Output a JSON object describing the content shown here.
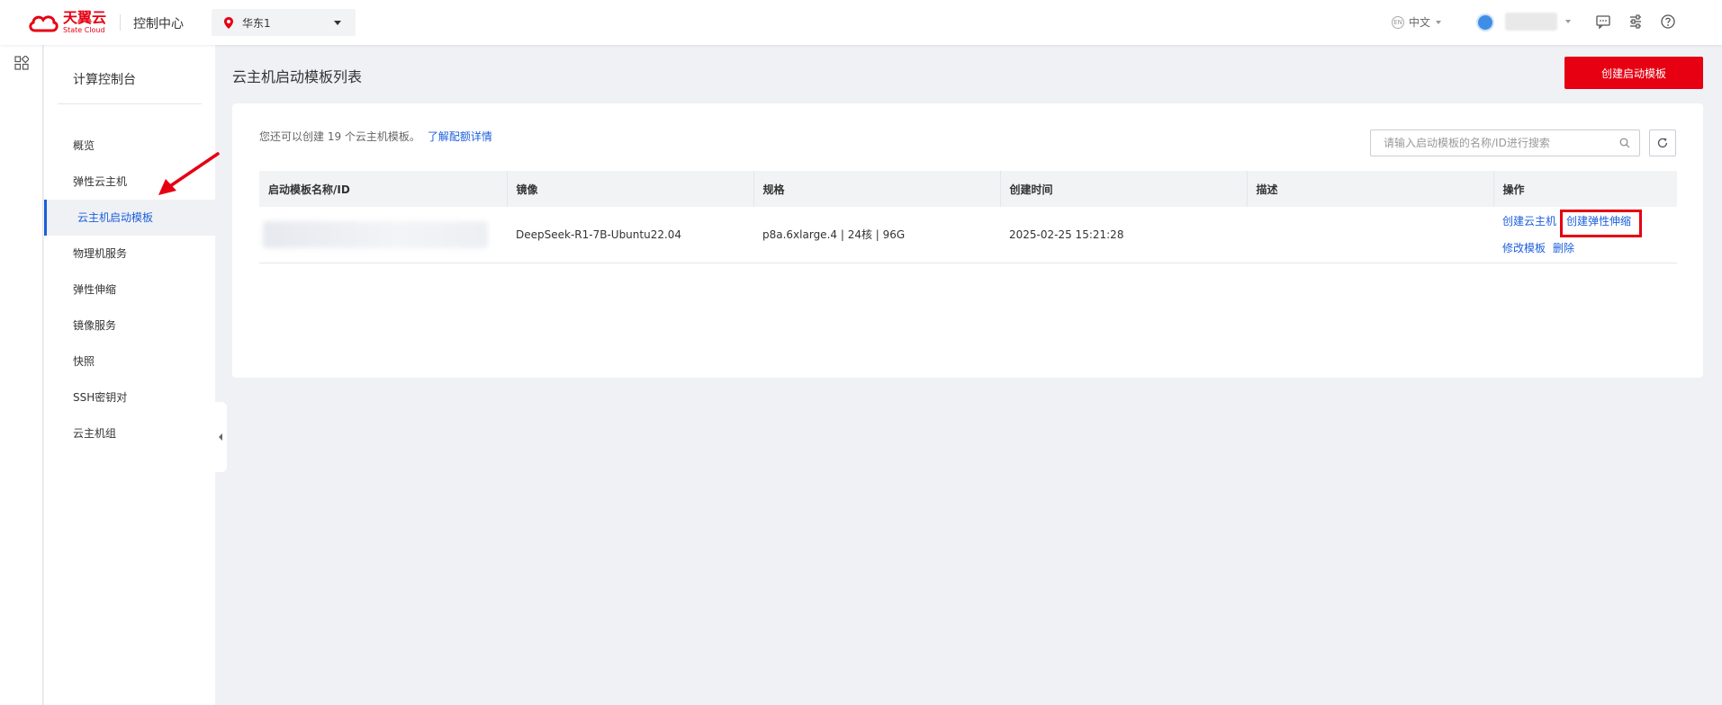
{
  "header": {
    "logo_cn": "天翼云",
    "logo_en": "State Cloud",
    "console_title": "控制中心",
    "region": "华东1",
    "language": "中文",
    "colors": {
      "brand": "#e60012",
      "link": "#1b5fdc"
    }
  },
  "sidebar": {
    "title": "计算控制台",
    "items": [
      {
        "label": "概览",
        "active": false
      },
      {
        "label": "弹性云主机",
        "active": false
      },
      {
        "label": "云主机启动模板",
        "active": true
      },
      {
        "label": "物理机服务",
        "active": false
      },
      {
        "label": "弹性伸缩",
        "active": false
      },
      {
        "label": "镜像服务",
        "active": false
      },
      {
        "label": "快照",
        "active": false
      },
      {
        "label": "SSH密钥对",
        "active": false
      },
      {
        "label": "云主机组",
        "active": false
      }
    ]
  },
  "main": {
    "title": "云主机启动模板列表",
    "create_button": "创建启动模板",
    "quota_text": "您还可以创建 19 个云主机模板。",
    "quota_link": "了解配额详情",
    "search_placeholder": "请输入启动模板的名称/ID进行搜索",
    "table": {
      "headers": [
        "启动模板名称/ID",
        "镜像",
        "规格",
        "创建时间",
        "描述",
        "操作"
      ],
      "rows": [
        {
          "image": "DeepSeek-R1-7B-Ubuntu22.04",
          "spec": "p8a.6xlarge.4 | 24核 | 96G",
          "created": "2025-02-25 15:21:28",
          "description": "",
          "actions": [
            "创建云主机",
            "创建弹性伸缩",
            "修改模板",
            "删除"
          ]
        }
      ]
    }
  }
}
